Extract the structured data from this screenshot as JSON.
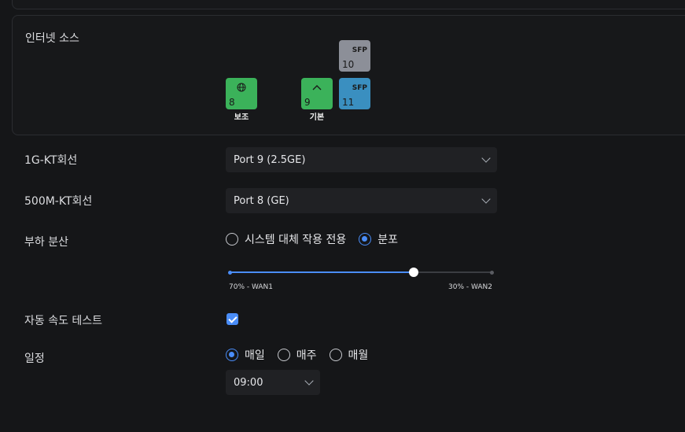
{
  "internet_source": {
    "title": "인터넷 소스",
    "ports": [
      {
        "number": "8",
        "type": "globe-icon",
        "caption": "보조",
        "color": "#3bb25a"
      },
      {
        "number": "9",
        "type": "chevron-up-icon",
        "caption": "기본",
        "color": "#3bb25a"
      },
      {
        "number": "10",
        "badge": "SFP",
        "color": "#8c8f98"
      },
      {
        "number": "11",
        "badge": "SFP",
        "color": "#3a8fc0"
      }
    ]
  },
  "wan1": {
    "label": "1G-KT회선",
    "value": "Port 9 (2.5GE)"
  },
  "wan2": {
    "label": "500M-KT회선",
    "value": "Port 8 (GE)"
  },
  "load_balance": {
    "label": "부하 분산",
    "options": [
      "시스템 대체 작용 전용",
      "분포"
    ],
    "selected": "분포",
    "slider": {
      "wan1_percent": 70,
      "left_label": "70% - WAN1",
      "right_label": "30% - WAN2"
    }
  },
  "speed_test": {
    "label": "자동 속도 테스트",
    "checked": true
  },
  "schedule": {
    "label": "일정",
    "options": [
      "매일",
      "매주",
      "매월"
    ],
    "selected": "매일",
    "time": "09:00"
  },
  "colors": {
    "accent": "#4a8df8",
    "port_green": "#3bb25a"
  }
}
